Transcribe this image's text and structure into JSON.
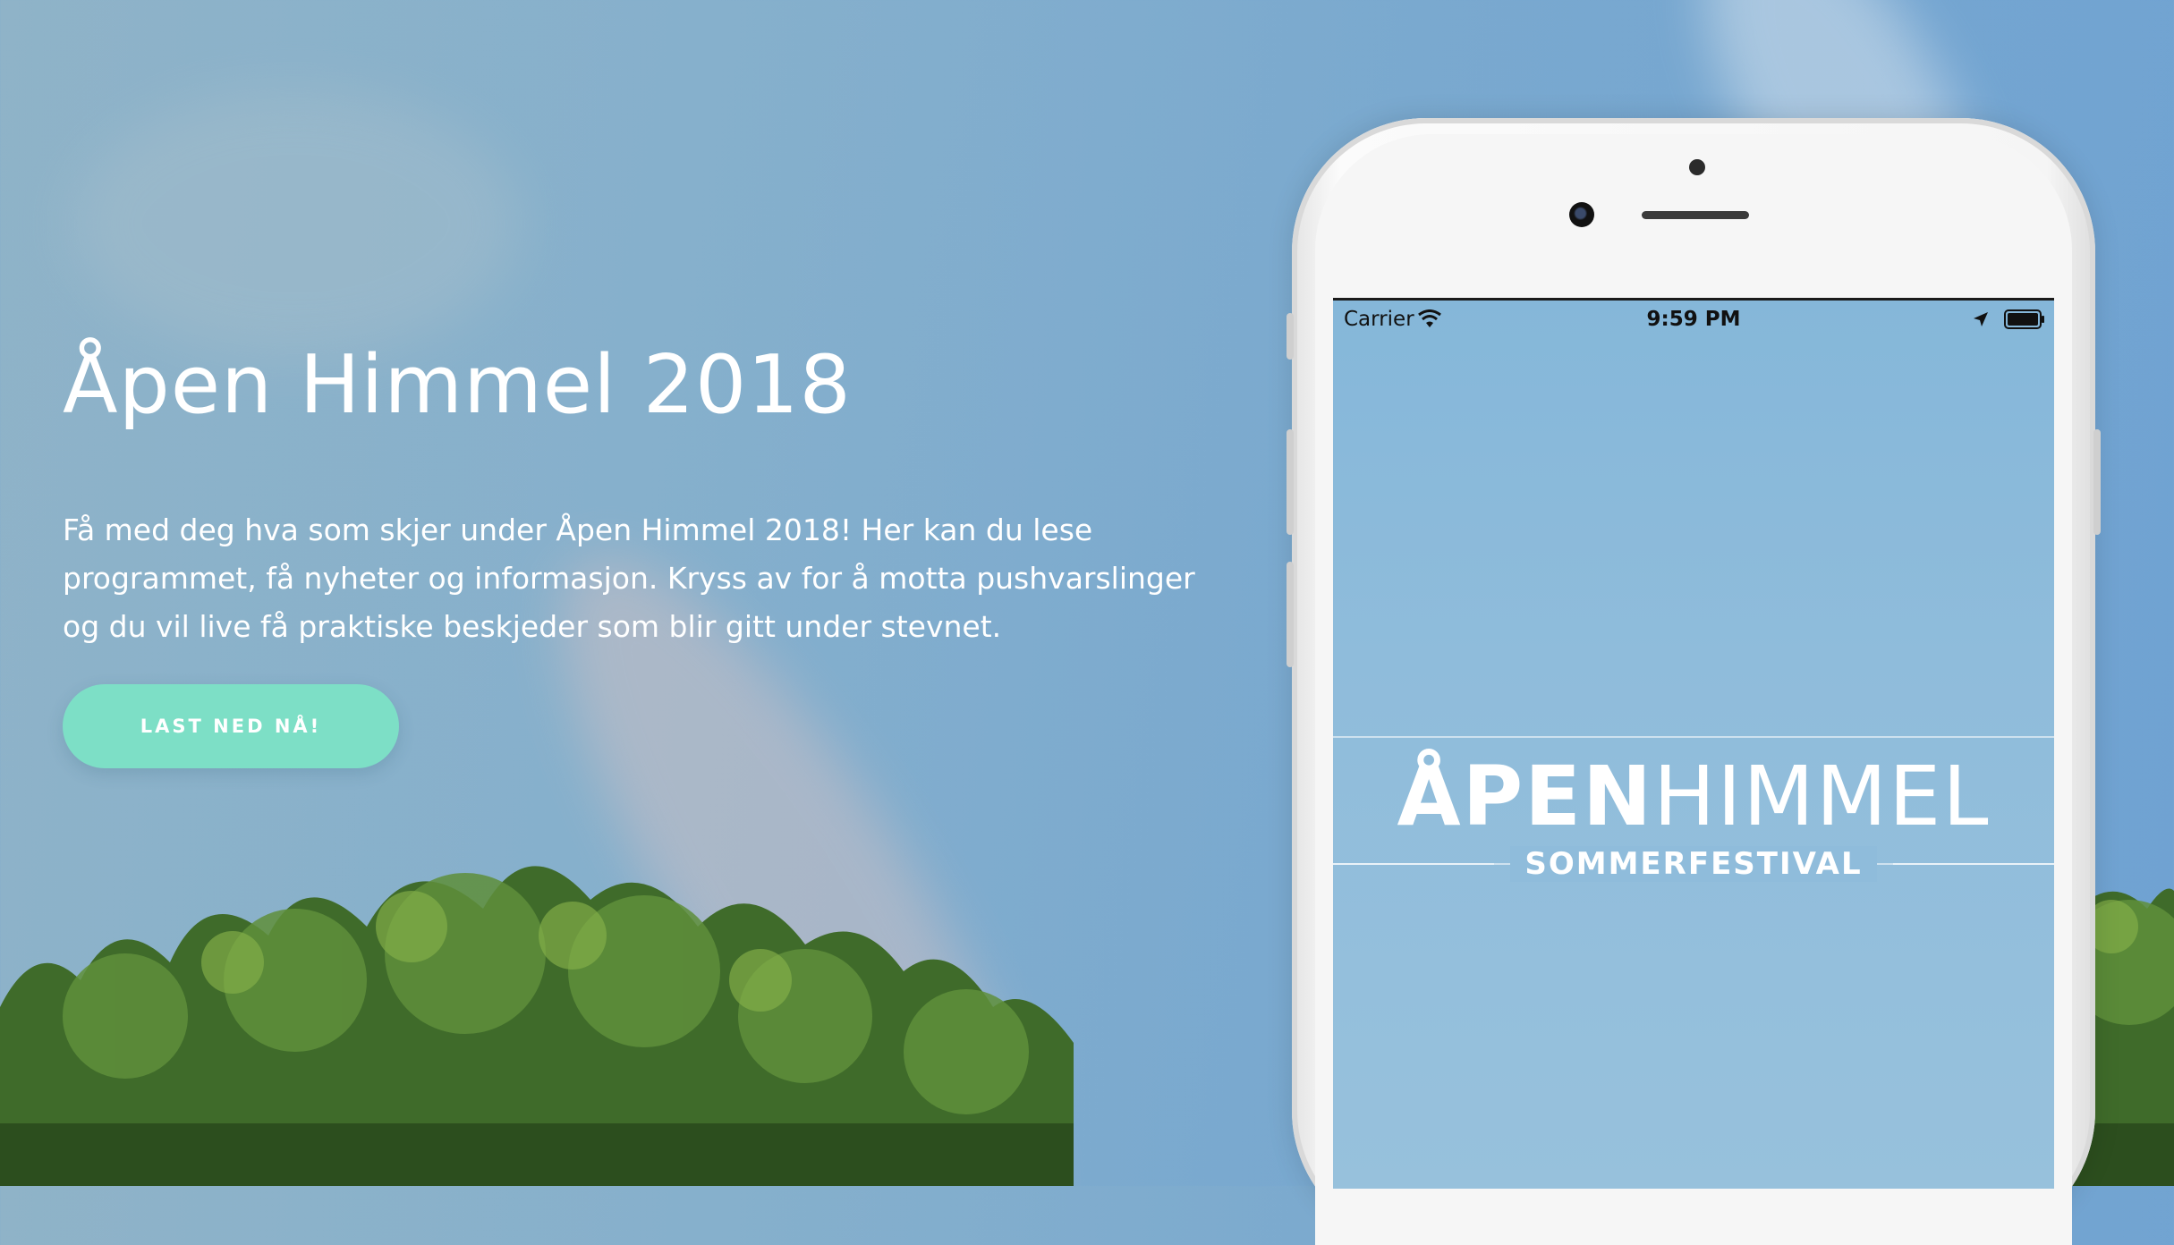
{
  "hero": {
    "title": "Åpen Himmel 2018",
    "description": "Få med deg hva som skjer under Åpen Himmel 2018! Her kan du lese programmet, få nyheter og informasjon. Kryss av for å motta pushvarslinger og du vil live få praktiske beskjeder som blir gitt under stevnet.",
    "cta_label": "LAST NED NÅ!"
  },
  "phone": {
    "status_bar": {
      "carrier": "Carrier",
      "time": "9:59 PM"
    },
    "logo": {
      "word_bold": "ÅPEN",
      "word_thin": "HIMMEL",
      "subtitle": "SOMMERFESTIVAL"
    }
  },
  "colors": {
    "cta": "#7ddfc6",
    "sky": "#86b0cc",
    "text": "#ffffff"
  },
  "icons": [
    "wifi-icon",
    "location-arrow-icon",
    "battery-icon",
    "camera-icon",
    "speaker-icon"
  ]
}
